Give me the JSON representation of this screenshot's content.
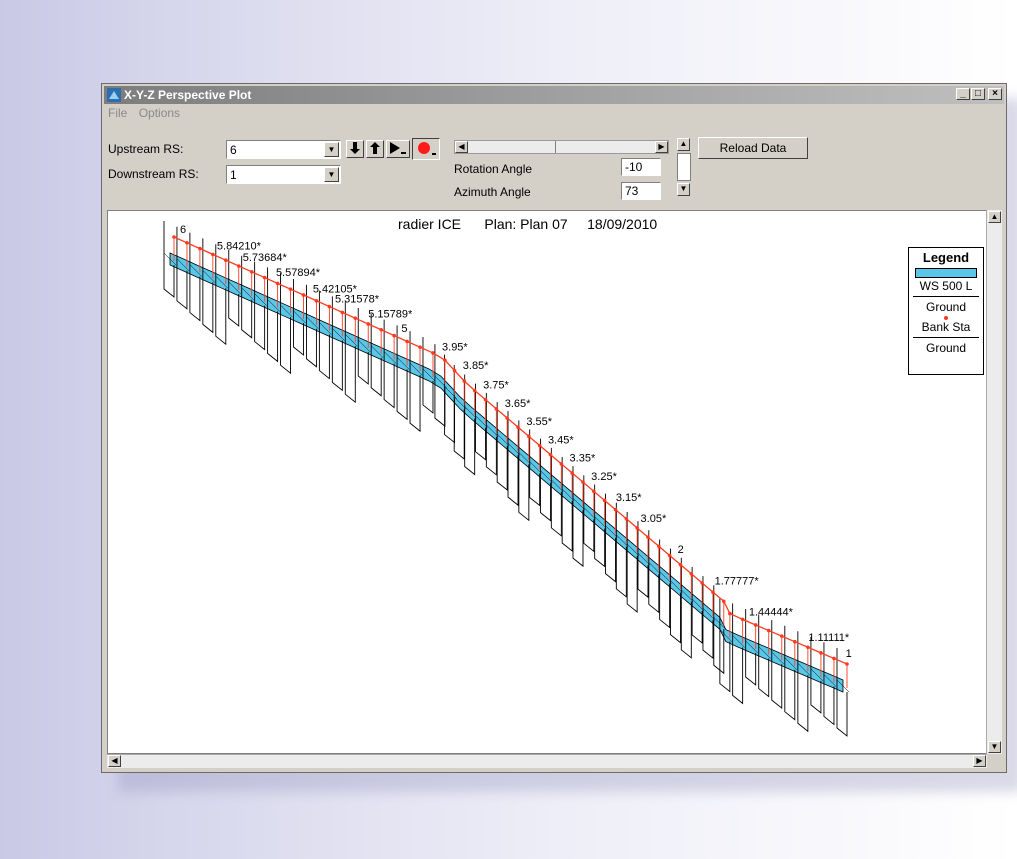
{
  "window": {
    "title": "X-Y-Z Perspective Plot"
  },
  "menu": [
    "File",
    "Options"
  ],
  "controls": {
    "upstream_label": "Upstream RS:",
    "upstream_value": "6",
    "downstream_label": "Downstream RS:",
    "downstream_value": "1",
    "rotation_label": "Rotation Angle",
    "rotation_value": "-10",
    "azimuth_label": "Azimuth Angle",
    "azimuth_value": "73",
    "reload_label": "Reload Data"
  },
  "plot": {
    "title_project": "radier ICE",
    "title_plan": "Plan: Plan 07",
    "title_date": "18/09/2010",
    "station_labels": [
      "6",
      "5.84210*",
      "5.73684*",
      "5.57894*",
      "5.42105*",
      "5.31578*",
      "5.15789*",
      "5",
      "3.95*",
      "3.85*",
      "3.75*",
      "3.65*",
      "3.55*",
      "3.45*",
      "3.35*",
      "3.25*",
      "3.15*",
      "3.05*",
      "2",
      "1.77777*",
      "1.44444*",
      "1.11111*",
      "1"
    ],
    "colors": {
      "water": "#5ac6e8",
      "bank": "#ff3b1f",
      "ground": "#000000"
    }
  },
  "legend": {
    "title": "Legend",
    "items": [
      "WS 500 L",
      "Ground",
      "Bank Sta",
      "Ground"
    ]
  }
}
